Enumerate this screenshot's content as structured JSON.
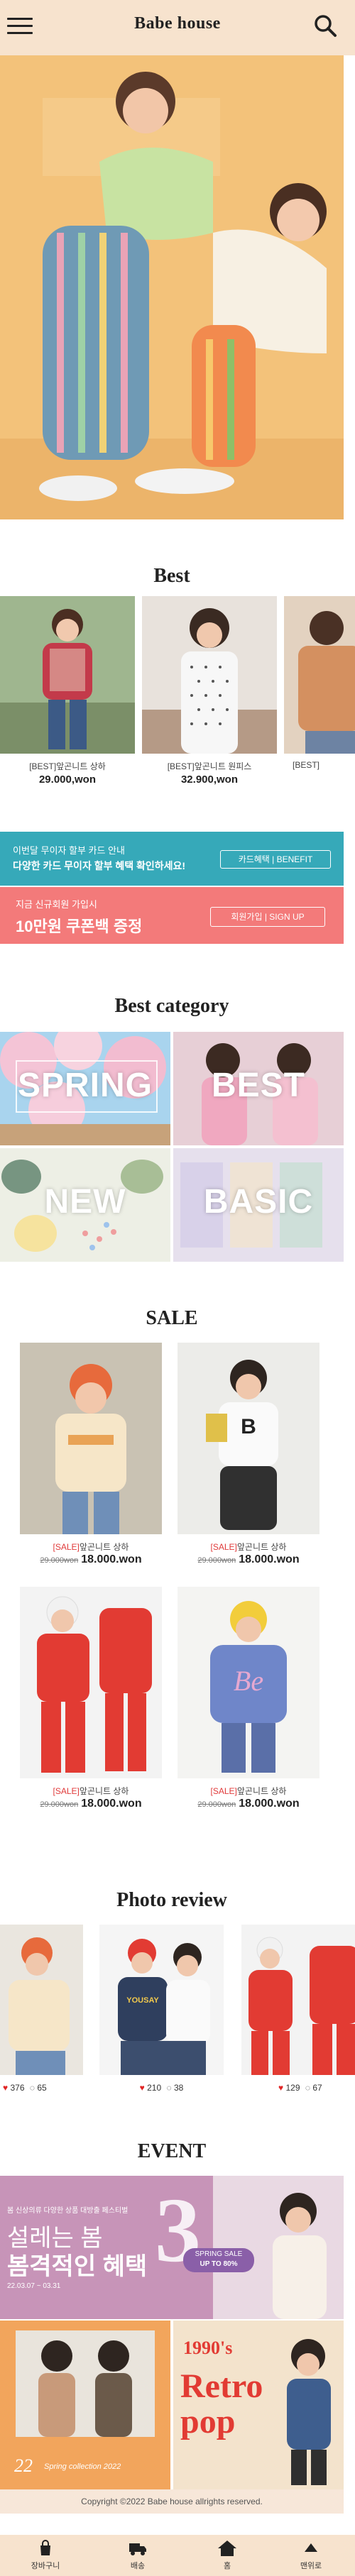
{
  "header": {
    "title": "Babe house",
    "menu_icon": "hamburger-icon",
    "search_icon": "search-icon"
  },
  "sections": {
    "best": "Best",
    "best_category": "Best category",
    "sale": "SALE",
    "photo_review": "Photo review",
    "event": "EVENT"
  },
  "best_products": [
    {
      "name": "[BEST]앞곤니트 상하",
      "price": "29.000,won"
    },
    {
      "name": "[BEST]앞곤니트 원피스",
      "price": "32.900,won"
    },
    {
      "name": "[BEST]",
      "price": ""
    }
  ],
  "banners": {
    "card": {
      "line1": "이번달 무이자 할부 카드 안내",
      "line2": "다양한 카드 무이자 할부 혜택 확인하세요!",
      "button": "카드혜택 | BENEFIT"
    },
    "signup": {
      "line1": "지금 신규회원 가입시",
      "line2": "10만원 쿠폰백 증정",
      "button": "회원가입 | SIGN UP"
    }
  },
  "categories": [
    {
      "label": "SPRING"
    },
    {
      "label": "BEST"
    },
    {
      "label": "NEW"
    },
    {
      "label": "BASIC"
    }
  ],
  "sale_products": [
    {
      "tag": "[SALE]",
      "name": "앞곤니트 상하",
      "old_price": "29.000won",
      "price": "18.000.won"
    },
    {
      "tag": "[SALE]",
      "name": "앞곤니트 상하",
      "old_price": "29.000won",
      "price": "18.000.won"
    },
    {
      "tag": "[SALE]",
      "name": "앞곤니트 상하",
      "old_price": "29.000won",
      "price": "18.000.won"
    },
    {
      "tag": "[SALE]",
      "name": "앞곤니트 상하",
      "old_price": "29.000won",
      "price": "18.000.won"
    }
  ],
  "reviews": [
    {
      "likes": "376",
      "comments": "65"
    },
    {
      "likes": "210",
      "comments": "38"
    },
    {
      "likes": "129",
      "comments": "67"
    }
  ],
  "events": {
    "spring": {
      "small": "봄 신상의류 다양한 상품 대방출 페스티벌",
      "line1": "설레는 봄",
      "line2": "봄격적인 혜택",
      "number": "3",
      "badge1": "SPRING SALE",
      "badge2": "UP TO 80%",
      "date": "22.03.07 ~ 03.31"
    },
    "card22": {
      "big": "22",
      "small": "Spring collection 2022"
    },
    "retro": {
      "line1": "1990's",
      "line2": "Retro",
      "line3": "pop"
    }
  },
  "copyright": "Copyright ©2022 Babe house allrights reserved.",
  "tabbar": [
    {
      "label": "장바구니",
      "icon": "cart-icon"
    },
    {
      "label": "배송",
      "icon": "truck-icon"
    },
    {
      "label": "홈",
      "icon": "home-icon"
    },
    {
      "label": "맨위로",
      "icon": "arrow-up-icon"
    }
  ],
  "colors": {
    "header_bg": "#f7e3ce",
    "banner_card": "#36a9b9",
    "banner_signup": "#f37a7a",
    "sale_tag": "#e03a3a",
    "event_purple": "#c794b8"
  }
}
